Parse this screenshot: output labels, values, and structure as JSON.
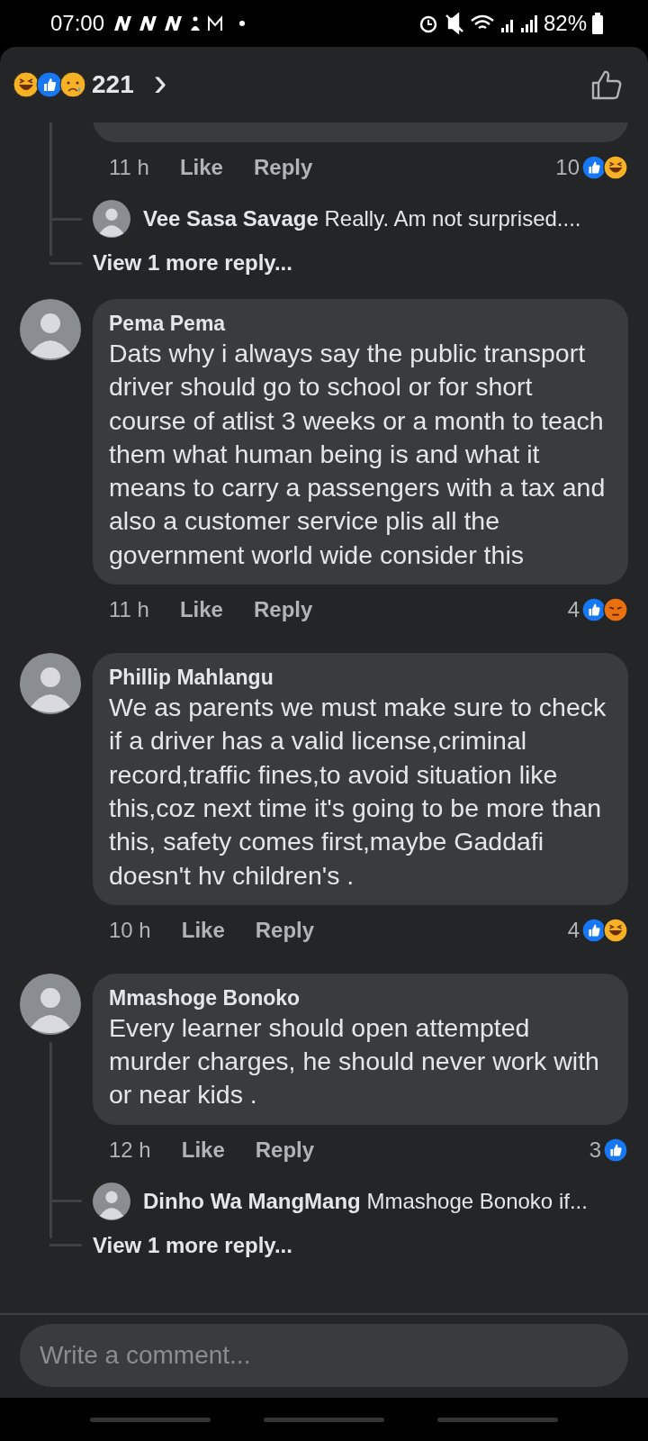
{
  "status_bar": {
    "time": "07:00",
    "battery": "82%"
  },
  "header": {
    "reactions": [
      {
        "kind": "haha"
      },
      {
        "kind": "like"
      },
      {
        "kind": "sad"
      }
    ],
    "count": "221",
    "chevron": "›"
  },
  "comments": [
    {
      "kind": "partial",
      "time": "11 h",
      "like": "Like",
      "reply": "Reply",
      "reaction_count": "10",
      "reactions": [
        {
          "kind": "like"
        },
        {
          "kind": "haha"
        }
      ],
      "reply_preview": {
        "name": "Vee Sasa Savage",
        "text": "Really. Am not surprised...."
      },
      "more": "View 1 more reply..."
    },
    {
      "kind": "full",
      "name": "Pema Pema",
      "text": "Dats why i always say the public transport driver should go to school or for short course of atlist 3 weeks or a month to teach them what human being is and what it means to carry a passengers with a tax and also a customer service plis all the government world wide consider this",
      "time": "11 h",
      "like": "Like",
      "reply": "Reply",
      "reaction_count": "4",
      "reactions": [
        {
          "kind": "like"
        },
        {
          "kind": "angry"
        }
      ]
    },
    {
      "kind": "full",
      "name": "Phillip Mahlangu",
      "text": "We as parents we must make sure to check if a driver has a valid license,criminal record,traffic fines,to avoid situation like this,coz next time it's going to be more than this, safety comes first,maybe Gaddafi  doesn't hv children's .",
      "time": "10 h",
      "like": "Like",
      "reply": "Reply",
      "reaction_count": "4",
      "reactions": [
        {
          "kind": "like"
        },
        {
          "kind": "haha"
        }
      ]
    },
    {
      "kind": "full",
      "name": "Mmashoge Bonoko",
      "text": "Every learner should open attempted murder charges, he should never work with or near kids .",
      "time": "12 h",
      "like": "Like",
      "reply": "Reply",
      "reaction_count": "3",
      "reactions": [
        {
          "kind": "like"
        }
      ],
      "reply_preview": {
        "name": "Dinho Wa MangMang",
        "text": "Mmashoge Bonoko if..."
      },
      "more": "View 1 more reply..."
    }
  ],
  "composer": {
    "placeholder": "Write a comment..."
  }
}
